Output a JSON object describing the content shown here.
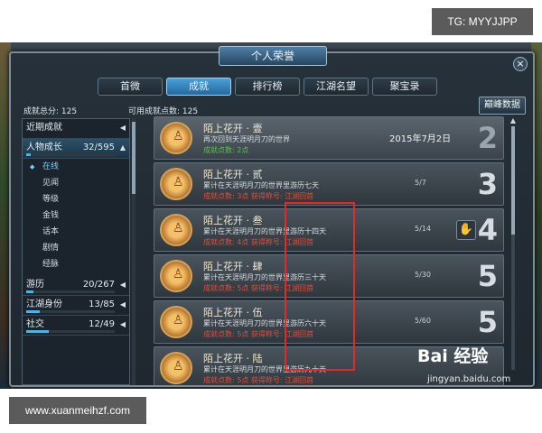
{
  "overlay": {
    "tg": "TG: MYYJJPP",
    "site": "www.xuanmeihzf.com"
  },
  "window": {
    "title": "个人荣誉",
    "close": "×"
  },
  "tabs": [
    "首微",
    "成就",
    "排行榜",
    "江湖名望",
    "聚宝录"
  ],
  "active_tab": "成就",
  "stats": {
    "total": "成就总分: 125",
    "available": "可用成就点数: 125"
  },
  "peak_button": "巅峰数据",
  "categories": [
    {
      "label": "近期成就",
      "num": "",
      "selected": false
    },
    {
      "label": "人物成长",
      "num": "32/595",
      "selected": true,
      "progress": 0.054
    }
  ],
  "subcategories": [
    "在线",
    "见闻",
    "等级",
    "金钱",
    "话本",
    "剧情",
    "经脉"
  ],
  "active_sub": "在线",
  "categories_bottom": [
    {
      "label": "游历",
      "num": "20/267",
      "progress": 0.075
    },
    {
      "label": "江湖身份",
      "num": "13/85",
      "progress": 0.153
    },
    {
      "label": "社交",
      "num": "12/49",
      "progress": 0.245
    }
  ],
  "achievements": [
    {
      "title": "陌上花开 · 壹",
      "desc": "再次回到天涯明月刀的世界",
      "reward": "成就点数: 2点",
      "reward_green": true,
      "date": "2015年7月2日",
      "progress": "",
      "points": "2"
    },
    {
      "title": "陌上花开 · 贰",
      "desc": "累计在天涯明月刀的世界里游历七天",
      "reward": "成就点数: 3点 获得称号: 江湖回首",
      "reward_green": false,
      "date": "",
      "progress": "5/7",
      "points": "3"
    },
    {
      "title": "陌上花开 · 叁",
      "desc": "累计在天涯明月刀的世界里游历十四天",
      "reward": "成就点数: 4点 获得称号: 江湖回首",
      "reward_green": false,
      "date": "",
      "progress": "5/14",
      "points": "4",
      "claim": true
    },
    {
      "title": "陌上花开 · 肆",
      "desc": "累计在天涯明月刀的世界里游历三十天",
      "reward": "成就点数: 5点 获得称号: 江湖回首",
      "reward_green": false,
      "date": "",
      "progress": "5/30",
      "points": "5"
    },
    {
      "title": "陌上花开 · 伍",
      "desc": "累计在天涯明月刀的世界里游历六十天",
      "reward": "成就点数: 5点 获得称号: 江湖回首",
      "reward_green": false,
      "date": "",
      "progress": "5/60",
      "points": "5"
    },
    {
      "title": "陌上花开 · 陆",
      "desc": "累计在天涯明月刀的世界里游历九十天",
      "reward": "成就点数: 5点 获得称号: 江湖回首",
      "reward_green": false,
      "date": "",
      "progress": "",
      "points": ""
    }
  ],
  "watermark": {
    "brand": "Bai 经验",
    "url": "jingyan.baidu.com"
  }
}
